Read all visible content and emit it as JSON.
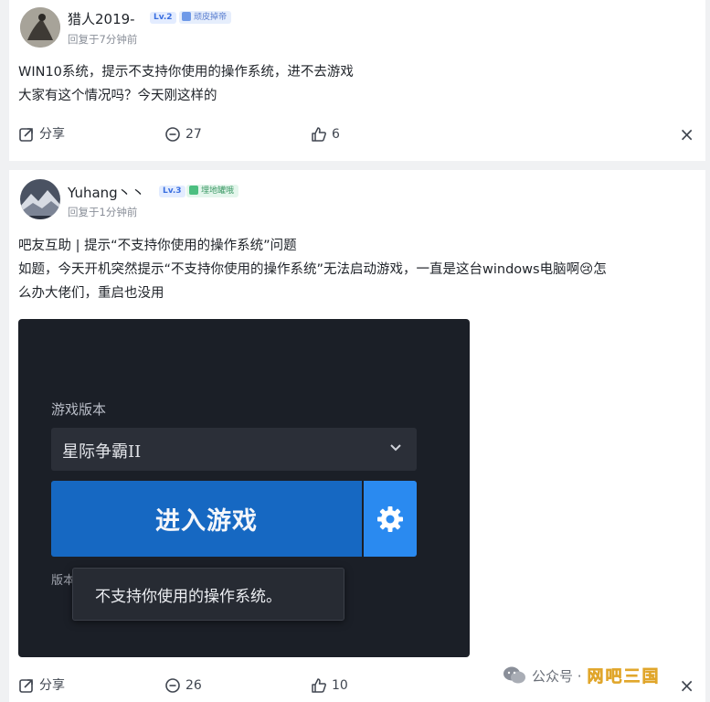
{
  "post1": {
    "username": "猎人2019-",
    "level": "Lv.2",
    "title_badge": "顽皮掉帝",
    "time": "回复于7分钟前",
    "content_lines": [
      "WIN10系统，提示不支持你使用的操作系统，进不去游戏",
      "大家有这个情况吗？今天刚这样的"
    ],
    "share_label": "分享",
    "comment_count": "27",
    "like_count": "6",
    "close_glyph": "×"
  },
  "post2": {
    "username": "Yuhang丶丶",
    "level": "Lv.3",
    "title_badge": "埋地罐哦",
    "time": "回复于1分钟前",
    "content_lines": [
      "吧友互助 | 提示“不支持你使用的操作系统”问题",
      "如题，今天开机突然提示“不支持你使用的操作系统”无法启动游戏，一直是这台windows电脑啊😢怎",
      "么办大佬们，重启也没用"
    ],
    "share_label": "分享",
    "comment_count": "26",
    "like_count": "10",
    "close_glyph": "×"
  },
  "game_screenshot": {
    "section_label": "游戏版本",
    "selected_version": "星际争霸II",
    "play_button": "进入游戏",
    "version_label": "版本",
    "tooltip": "不支持你使用的操作系统。"
  },
  "watermark": {
    "text": "公众号 ·",
    "brand": "网吧三国"
  },
  "colors": {
    "page_bg": "#f0f1f3",
    "card_bg": "#ffffff",
    "game_bg": "#1b1f27",
    "play_blue": "#1668c2",
    "gear_blue": "#2a8af0",
    "level_blue": "#3a6fe0"
  }
}
